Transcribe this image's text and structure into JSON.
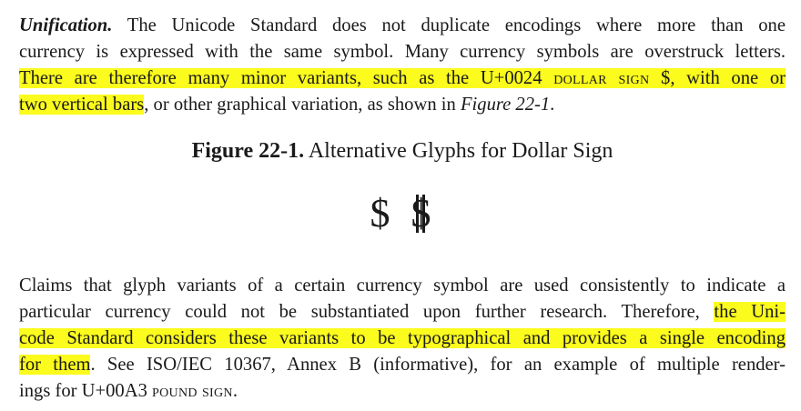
{
  "para1": {
    "runin": "Unification.",
    "l1_rest": " The Unicode Standard does not duplicate encodings where more than one",
    "l2": "currency is expressed with the same symbol. Many currency symbols are overstruck letters.",
    "l3_a": "There are therefore many minor variants, such as the U+0024 ",
    "l3_sc": "dollar sign",
    "l3_b": " $, with one or",
    "l4_hl": "two vertical bars",
    "l4_a": ", or other graphical variation, as shown in ",
    "l4_ital": "Figure 22-1",
    "l4_end": "."
  },
  "figure": {
    "number": "Figure 22-1.",
    "title": "Alternative Glyphs for Dollar Sign",
    "glyph_one_bar": "$",
    "glyph_two_bar": "$"
  },
  "para2": {
    "l1": "Claims that glyph variants of a certain currency symbol are used consistently to indicate a",
    "l2_a": "particular currency could not be substantiated upon further research. Therefore, ",
    "l2_hl": "the Uni-",
    "l3_hl": "code Standard considers these variants to be typographical and provides a single encoding",
    "l4_hl": "for them",
    "l4_a": ". See ISO/IEC 10367, Annex B (informative), for an example of multiple render-",
    "l5_a": "ings for U+00A3 ",
    "l5_sc": "pound sign",
    "l5_end": "."
  },
  "colors": {
    "highlight": "#fbfb1e",
    "text": "#1a1a1a"
  }
}
